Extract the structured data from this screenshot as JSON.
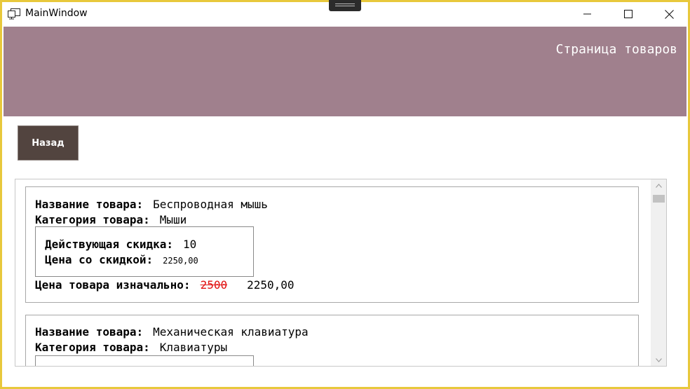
{
  "window": {
    "title": "MainWindow"
  },
  "header": {
    "title": "Страница товаров"
  },
  "nav": {
    "back_label": "Назад"
  },
  "labels": {
    "name": "Название товара:",
    "category": "Категория товара:",
    "discount": "Действующая скидка:",
    "discount_price": "Цена со скидкой:",
    "original_price": "Цена товара изначально:"
  },
  "products": [
    {
      "name": "Беспроводная мышь",
      "category": "Мыши",
      "discount": "10",
      "discount_price": "2250,00",
      "original_price": "2500",
      "final_price": "2250,00"
    },
    {
      "name": "Механическая клавиатура",
      "category": "Клавиатуры"
    }
  ],
  "colors": {
    "header_bg": "#a0808d",
    "button_bg": "#52443f",
    "old_price": "#e11010",
    "window_border": "#e8c83c"
  }
}
